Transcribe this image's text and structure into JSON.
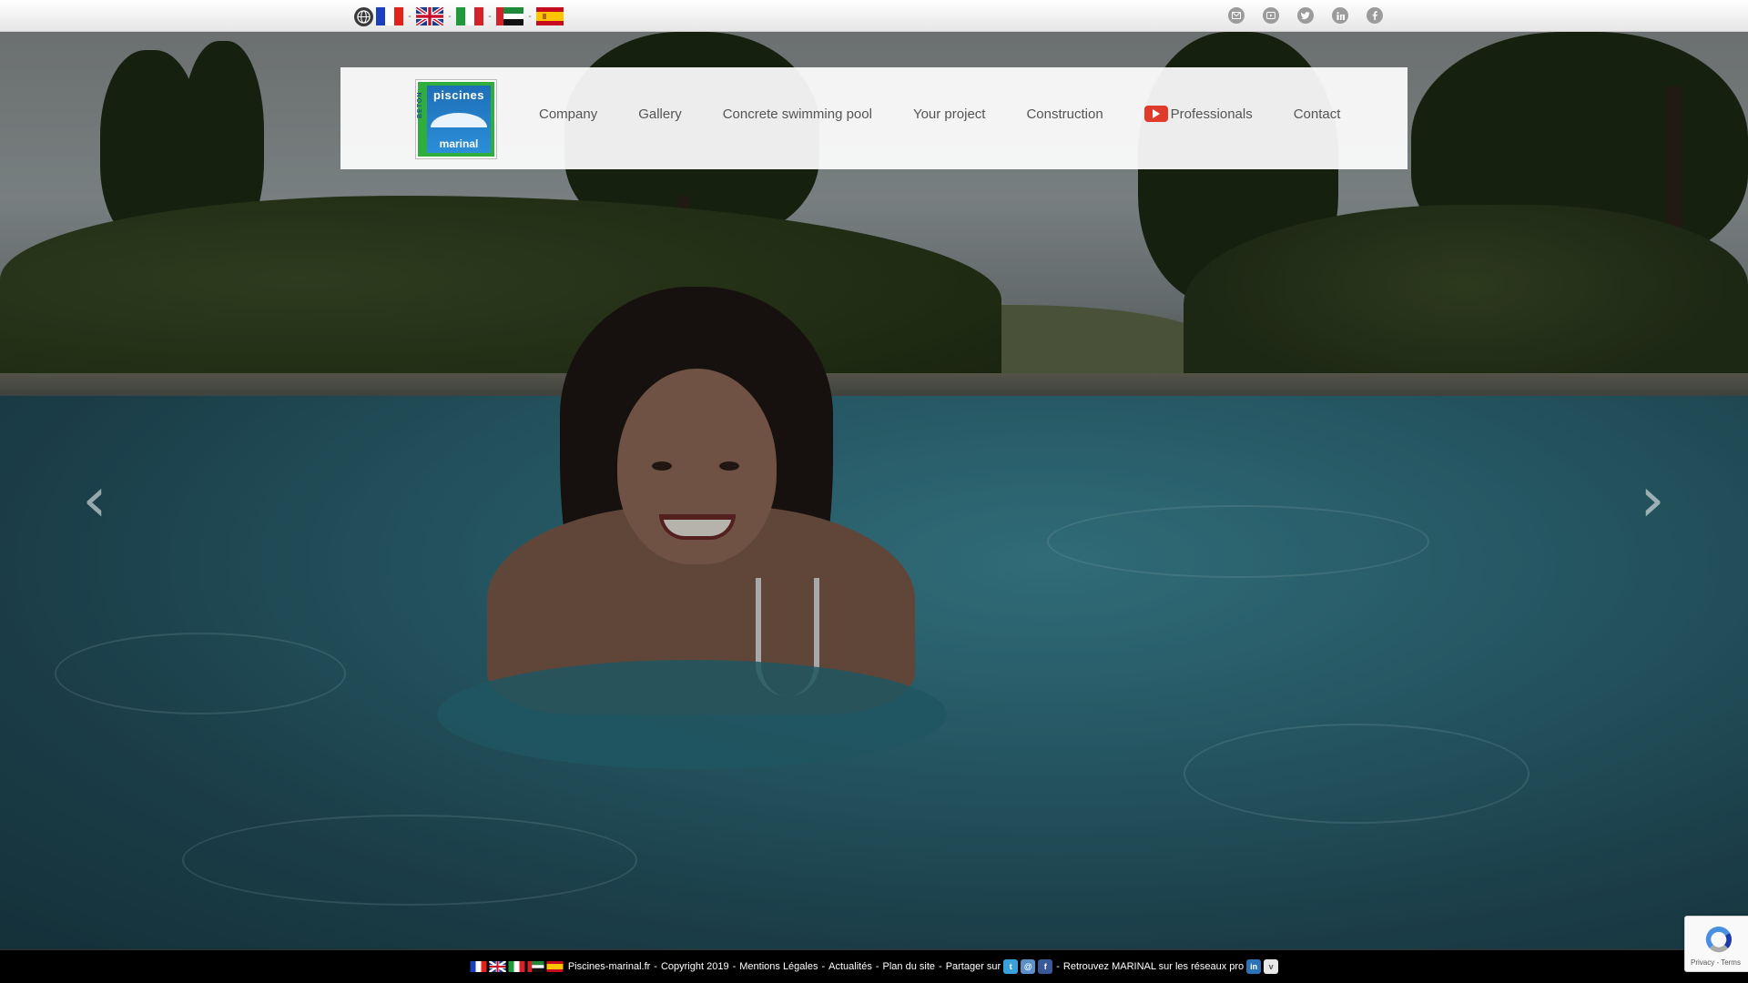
{
  "topbar": {
    "languages": [
      "French",
      "English",
      "Italian",
      "Arabic",
      "Spanish"
    ],
    "social_icons": [
      "mail-icon",
      "youtube-icon",
      "twitter-icon",
      "linkedin-icon",
      "facebook-icon"
    ]
  },
  "header": {
    "logo": {
      "top_text": "piscines",
      "bottom_text": "marinal",
      "side_text": "BETON"
    },
    "nav": {
      "company": "Company",
      "gallery": "Gallery",
      "concrete_pool": "Concrete swimming pool",
      "your_project": "Your project",
      "construction": "Construction",
      "professionals": "Professionals",
      "contact": "Contact"
    }
  },
  "carousel": {
    "prev_icon": "chevron-left-icon",
    "next_icon": "chevron-right-icon"
  },
  "footer": {
    "site": "Piscines-marinal.fr",
    "copyright": "Copyright 2019",
    "legal": "Mentions Légales",
    "news": "Actualités",
    "sitemap": "Plan du site",
    "share": "Partager sur",
    "pro_networks": "Retrouvez MARINAL sur les réseaux pro"
  },
  "recaptcha": {
    "text": "Privacy - Terms"
  },
  "colors": {
    "youtube_red": "#e03a2a",
    "logo_green": "#2fae3e",
    "logo_blue": "#1e6fb8",
    "nav_text": "#555555"
  }
}
